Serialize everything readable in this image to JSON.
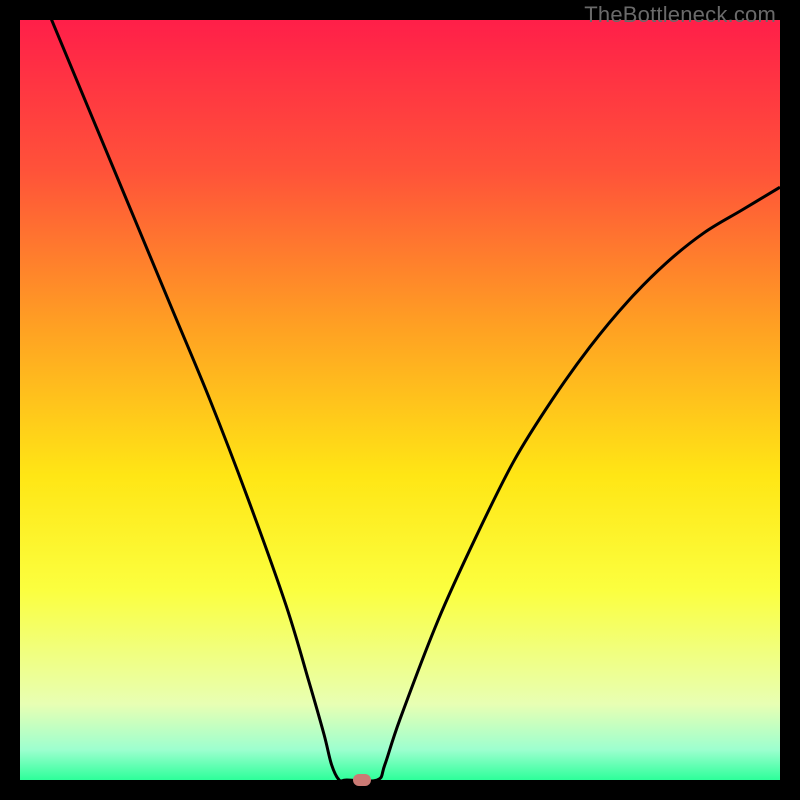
{
  "watermark": "TheBottleneck.com",
  "chart_data": {
    "type": "line",
    "title": "",
    "xlabel": "",
    "ylabel": "",
    "xlim": [
      0,
      100
    ],
    "ylim": [
      0,
      100
    ],
    "grid": false,
    "legend": false,
    "gradient_stops": [
      {
        "offset": 0.0,
        "color": "#ff1f49"
      },
      {
        "offset": 0.2,
        "color": "#ff5339"
      },
      {
        "offset": 0.4,
        "color": "#ff9f23"
      },
      {
        "offset": 0.6,
        "color": "#ffe615"
      },
      {
        "offset": 0.75,
        "color": "#fbff3f"
      },
      {
        "offset": 0.9,
        "color": "#e8ffb3"
      },
      {
        "offset": 0.96,
        "color": "#9dffcf"
      },
      {
        "offset": 1.0,
        "color": "#2dff9a"
      }
    ],
    "series": [
      {
        "name": "bottleneck-curve",
        "x": [
          0,
          5,
          10,
          15,
          20,
          25,
          30,
          35,
          38,
          40,
          41,
          42,
          43,
          47,
          48,
          50,
          55,
          60,
          65,
          70,
          75,
          80,
          85,
          90,
          95,
          100
        ],
        "y": [
          110,
          98,
          86,
          74,
          62,
          50,
          37,
          23,
          13,
          6,
          2,
          0,
          0,
          0,
          2,
          8,
          21,
          32,
          42,
          50,
          57,
          63,
          68,
          72,
          75,
          78
        ]
      }
    ],
    "marker": {
      "x": 45,
      "y": 0,
      "color": "#cb7a74"
    }
  }
}
